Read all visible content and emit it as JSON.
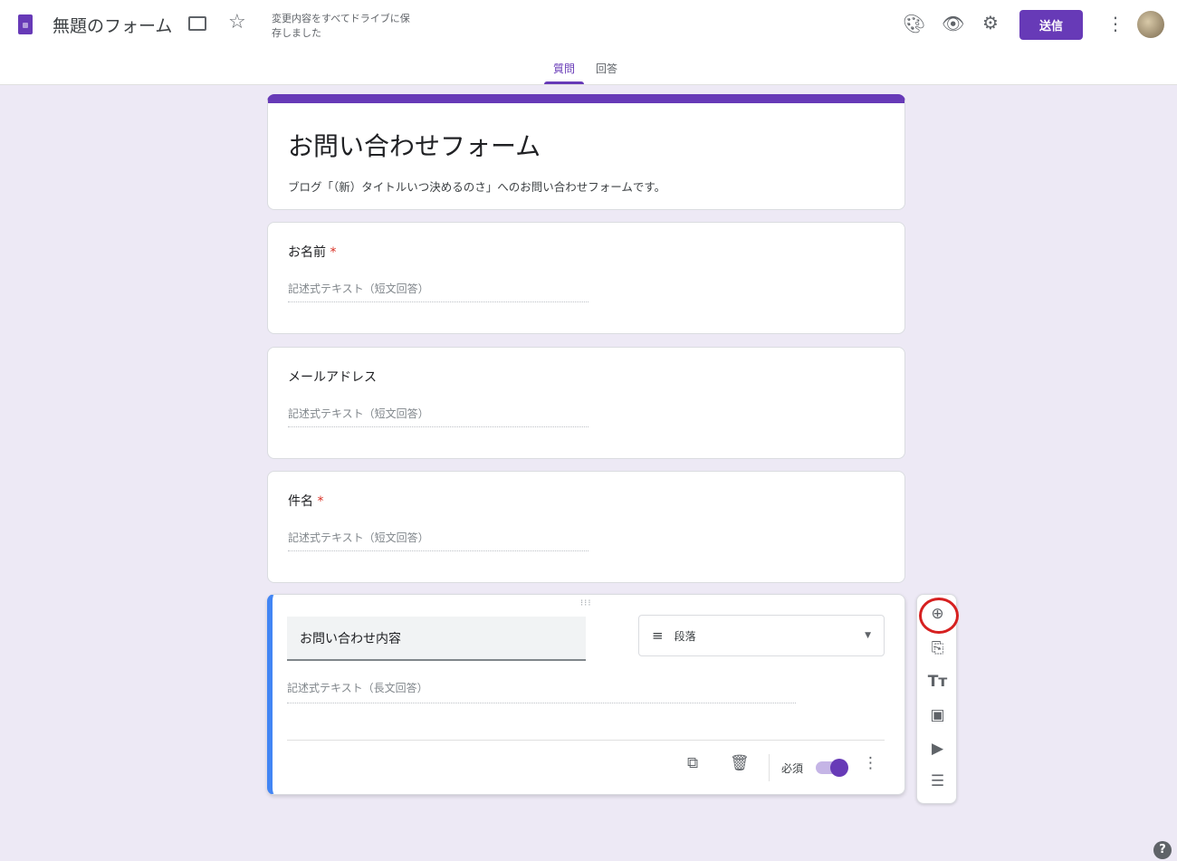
{
  "header": {
    "title": "無題のフォーム",
    "save_status": "変更内容をすべてドライブに保存しました",
    "send_label": "送信",
    "tabs": [
      {
        "label": "質問",
        "active": true
      },
      {
        "label": "回答",
        "active": false
      }
    ]
  },
  "form": {
    "title": "お問い合わせフォーム",
    "description": "ブログ「（新）タイトルいつ決めるのさ」へのお問い合わせフォームです。"
  },
  "questions": [
    {
      "label": "お名前",
      "required": "*",
      "answer_placeholder": "記述式テキスト（短文回答）"
    },
    {
      "label": "メールアドレス",
      "answer_placeholder": "記述式テキスト（短文回答）"
    },
    {
      "label": "件名",
      "required": "*",
      "answer_placeholder": "記述式テキスト（短文回答）"
    }
  ],
  "active_question": {
    "title": "お問い合わせ内容",
    "type": "段落",
    "answer_placeholder": "記述式テキスト（長文回答）",
    "required_label": "必須",
    "required_on": true
  },
  "colors": {
    "accent": "#673ab7",
    "active_border": "#4285f4",
    "highlight_circle": "#d62020"
  }
}
